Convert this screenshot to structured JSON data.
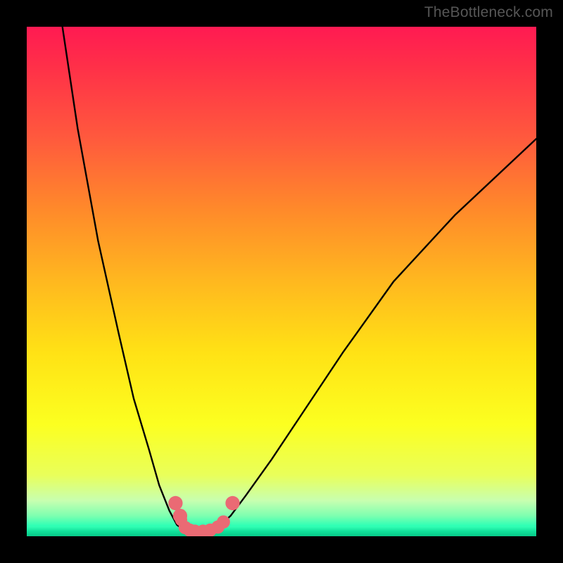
{
  "watermark": "TheBottleneck.com",
  "chart_data": {
    "type": "line",
    "title": "",
    "xlabel": "",
    "ylabel": "",
    "xlim": [
      0,
      100
    ],
    "ylim": [
      0,
      100
    ],
    "series": [
      {
        "name": "left-curve",
        "x": [
          7,
          10,
          14,
          18,
          21,
          24,
          26,
          28,
          29.5,
          30.5,
          31.5,
          32.5,
          34
        ],
        "y": [
          100,
          80,
          58,
          40,
          27,
          17,
          10,
          5,
          2.2,
          1.5,
          1.1,
          0.9,
          0.9
        ]
      },
      {
        "name": "right-curve",
        "x": [
          34,
          36,
          38,
          40,
          43,
          48,
          54,
          62,
          72,
          84,
          100
        ],
        "y": [
          0.9,
          1.2,
          2.2,
          4,
          8,
          15,
          24,
          36,
          50,
          63,
          78
        ]
      }
    ],
    "markers": [
      {
        "x": 29.2,
        "y": 6.5,
        "r": 1.4
      },
      {
        "x": 30.1,
        "y": 4.0,
        "r": 1.4
      },
      {
        "x": 30.3,
        "y": 3.2,
        "r": 1.2
      },
      {
        "x": 31.1,
        "y": 1.7,
        "r": 1.3
      },
      {
        "x": 32.0,
        "y": 1.2,
        "r": 1.3
      },
      {
        "x": 33.0,
        "y": 1.0,
        "r": 1.3
      },
      {
        "x": 34.6,
        "y": 1.0,
        "r": 1.3
      },
      {
        "x": 36.0,
        "y": 1.2,
        "r": 1.3
      },
      {
        "x": 37.5,
        "y": 1.8,
        "r": 1.3
      },
      {
        "x": 38.6,
        "y": 2.8,
        "r": 1.3
      },
      {
        "x": 40.4,
        "y": 6.5,
        "r": 1.4
      }
    ],
    "colors": {
      "curve": "#000000",
      "marker": "#ea6a74"
    }
  }
}
